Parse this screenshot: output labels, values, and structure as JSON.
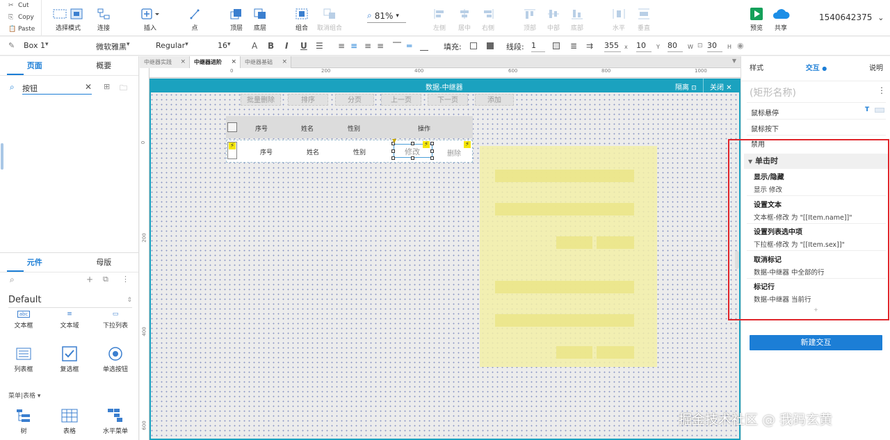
{
  "clipboard": {
    "cut": "Cut",
    "copy": "Copy",
    "paste": "Paste"
  },
  "toolbar": {
    "select_mode": "选择模式",
    "connect": "连接",
    "insert": "插入",
    "point": "点",
    "top_layer": "顶层",
    "bottom_layer": "底层",
    "group": "组合",
    "ungroup": "取消组合",
    "zoom": "81%",
    "align_left": "左侧",
    "align_center": "居中",
    "align_right": "右侧",
    "align_top": "顶部",
    "align_middle": "中部",
    "align_bottom": "底部",
    "distribute_h": "水平",
    "distribute_v": "垂直",
    "preview": "预览",
    "share": "共享",
    "user_id": "1540642375"
  },
  "format": {
    "element": "Box 1",
    "font": "微软雅黑",
    "weight": "Regular",
    "size": "16",
    "fill_label": "填充:",
    "line_label": "线段:",
    "line_width": "1",
    "x": "355",
    "y": "10",
    "w": "80",
    "h": "30",
    "x_lbl": "x",
    "y_lbl": "Y",
    "w_lbl": "W",
    "h_lbl": "H"
  },
  "left": {
    "tab_pages": "页面",
    "tab_outline": "概要",
    "search_value": "按钮",
    "tab_widgets": "元件",
    "tab_masters": "母版",
    "library": "Default",
    "items_row1": [
      "文本框",
      "文本域",
      "下拉列表"
    ],
    "items_row2": [
      "列表框",
      "复选框",
      "单选按钮"
    ],
    "section": "菜单|表格",
    "items_row3": [
      "树",
      "表格",
      "水平菜单"
    ]
  },
  "page_tabs": [
    "中继器实践",
    "中继器进阶",
    "中继器基础"
  ],
  "ruler": {
    "top": [
      "0",
      "200",
      "400",
      "600",
      "800",
      "1000"
    ],
    "left": [
      "0",
      "200",
      "400",
      "600"
    ]
  },
  "repeater": {
    "title": "数据-中继器",
    "isolate": "隔离",
    "close": "关闭",
    "buttons": [
      "批量删除",
      "排序",
      "分页",
      "上一页",
      "下一页",
      "添加"
    ],
    "headers": [
      "序号",
      "姓名",
      "性别",
      "操作"
    ],
    "row": [
      "序号",
      "姓名",
      "性别",
      "修改",
      "删除"
    ]
  },
  "right": {
    "tab_style": "样式",
    "tab_interaction": "交互",
    "tab_notes": "说明",
    "shape_name": "(矩形名称)",
    "events": [
      "鼠标悬停",
      "鼠标按下",
      "禁用"
    ],
    "click_section": "单击时",
    "actions": [
      {
        "title": "显示/隐藏",
        "desc": "显示 修改"
      },
      {
        "title": "设置文本",
        "desc": "文本框-修改 为 \"[[Item.name]]\""
      },
      {
        "title": "设置列表选中项",
        "desc": "下拉框-修改 为 \"[[Item.sex]]\""
      },
      {
        "title": "取消标记",
        "desc": "数据-中继器 中全部的行"
      },
      {
        "title": "标记行",
        "desc": "数据-中继器 当前行"
      }
    ],
    "new_interaction": "新建交互"
  },
  "watermark": "掘金技术社区 @ 我码玄黄"
}
